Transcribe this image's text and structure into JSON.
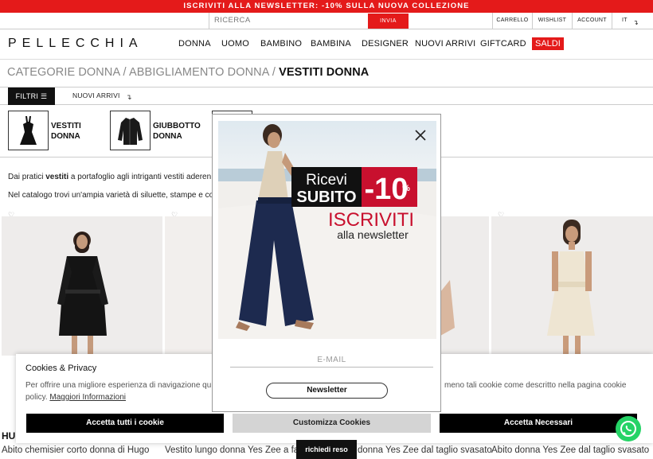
{
  "announcement": "ISCRIVITI ALLA NEWSLETTER: -10% SULLA NUOVA COLLEZIONE",
  "util": {
    "search_placeholder": "RICERCA",
    "send_label": "INVIA",
    "cart": "CARRELLO",
    "wishlist": "WISHLIST",
    "account": "ACCOUNT",
    "language": "IT"
  },
  "brand": "PELLECCHIA",
  "nav": [
    "DONNA",
    "UOMO",
    "BAMBINO",
    "BAMBINA",
    "DESIGNER",
    "NUOVI ARRIVI",
    "GIFTCARD"
  ],
  "nav_sale": "SALDI",
  "breadcrumb": {
    "part1": "CATEGORIE DONNA",
    "sep": " / ",
    "part2": "ABBIGLIAMENTO DONNA",
    "current": "VESTITI DONNA"
  },
  "filters": {
    "label": "FILTRI",
    "sort": "NUOVI ARRIVI"
  },
  "categories": [
    {
      "line1": "VESTITI",
      "line2": "DONNA"
    },
    {
      "line1": "GIUBBOTTO",
      "line2": "DONNA"
    }
  ],
  "description": {
    "line1_pre": "Dai pratici ",
    "line1_bold": "vestiti",
    "line1_post": " a portafoglio agli intriganti vestiti aderen",
    "line2": "Nel catalogo trovi un'ampia varietà di siluette, stampe e co"
  },
  "products": [
    {
      "brand": "HU",
      "name": "Abito chemisier corto donna di Hugo"
    },
    {
      "name": "Vestito lungo donna Yes Zee a fa"
    },
    {
      "name": "donna Yes Zee dal taglio svasato"
    },
    {
      "name": "Abito donna Yes Zee dal taglio svasato"
    }
  ],
  "cookie": {
    "title": "Cookies & Privacy",
    "text": "Per offrire una migliore esperienza di navigazione qu",
    "text_tail": "policy.",
    "more": "Maggiori Informazioni",
    "text_right": "meno tali cookie come descritto nella pagina cookie",
    "accept_all": "Accetta tutti i cookie",
    "customize": "Customizza Cookies",
    "accept_needed": "Accetta Necessari"
  },
  "modal": {
    "promo_line1": "Ricevi",
    "promo_line2": "SUBITO",
    "promo_discount": "-10",
    "promo_percent": "%",
    "promo_cta": "ISCRIVITI",
    "promo_sub": "alla newsletter",
    "email_placeholder": "E-MAIL",
    "button": "Newsletter"
  },
  "richiedi_reso": "richiedi reso",
  "colors": {
    "accent": "#e41a1a",
    "whatsapp": "#25d366",
    "promo_navy": "#1d2a4f"
  }
}
